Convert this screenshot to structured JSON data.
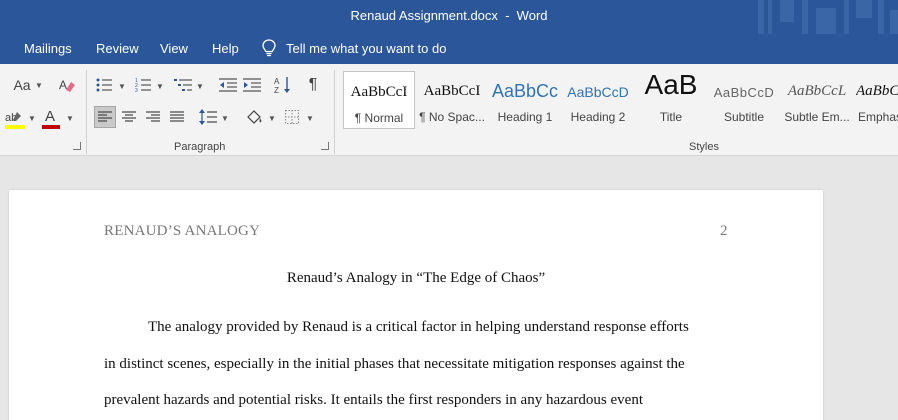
{
  "window": {
    "title": "Renaud Assignment.docx  -  Word"
  },
  "tabs": [
    {
      "label": "Mailings"
    },
    {
      "label": "Review"
    },
    {
      "label": "View"
    },
    {
      "label": "Help"
    }
  ],
  "tell_me": {
    "label": "Tell me what you want to do",
    "icon": "lightbulb-icon"
  },
  "ribbon": {
    "font_group": {
      "change_case": "Aa",
      "clear_formatting_icon": "eraser-icon",
      "highlight_icon": "highlighter-icon",
      "font_color_label": "A",
      "font_color": "#c00000",
      "highlight_color": "#ffff00"
    },
    "paragraph_group": {
      "label": "Paragraph",
      "show_marks": "¶"
    },
    "styles_group": {
      "label": "Styles",
      "items": [
        {
          "sample": "AaBbCcI",
          "name": "¶ Normal",
          "selected": true
        },
        {
          "sample": "AaBbCcI",
          "name": "¶ No Spac..."
        },
        {
          "sample": "AaBbCc",
          "name": "Heading 1"
        },
        {
          "sample": "AaBbCcD",
          "name": "Heading 2"
        },
        {
          "sample": "AaB",
          "name": "Title"
        },
        {
          "sample": "AaBbCcD",
          "name": "Subtitle"
        },
        {
          "sample": "AaBbCcL",
          "name": "Subtle Em..."
        },
        {
          "sample": "AaBbCcL",
          "name": "Emphas"
        }
      ]
    }
  },
  "document": {
    "running_head": "RENAUD’S ANALOGY",
    "page_number": "2",
    "title": "Renaud’s Analogy in “The Edge of Chaos”",
    "lines": [
      "The analogy provided by Renaud is a critical factor in helping understand response efforts",
      "in distinct scenes, especially in the initial phases that necessitate mitigation responses against the",
      "prevalent hazards and potential risks. It entails the first responders in any hazardous event"
    ]
  },
  "colors": {
    "accent": "#2b579a",
    "ribbon_bg": "#f3f3f3",
    "canvas_bg": "#e6e6e6"
  }
}
